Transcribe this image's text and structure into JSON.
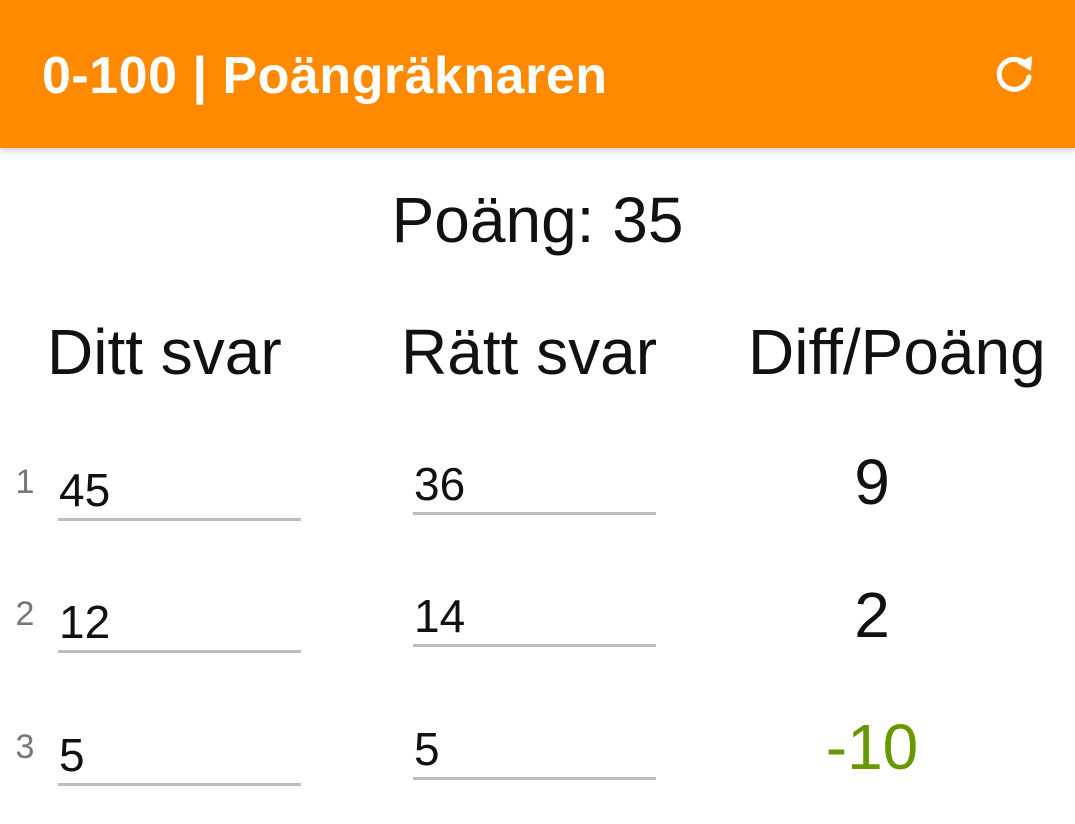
{
  "toolbar": {
    "title": "0-100 | Poängräknaren",
    "refresh_icon": "refresh-icon",
    "background_color": "#FF8A00"
  },
  "score": {
    "text": "Poäng: 35"
  },
  "columns": {
    "your_answer": "Ditt svar",
    "correct_answer": "Rätt svar",
    "diff_points": "Diff/Poäng"
  },
  "rows": [
    {
      "number": "1",
      "your_answer": "45",
      "correct_answer": "36",
      "diff": "9",
      "diff_color": "#111111"
    },
    {
      "number": "2",
      "your_answer": "12",
      "correct_answer": "14",
      "diff": "2",
      "diff_color": "#111111"
    },
    {
      "number": "3",
      "your_answer": "5",
      "correct_answer": "5",
      "diff": "-10",
      "diff_color": "#669900"
    }
  ]
}
